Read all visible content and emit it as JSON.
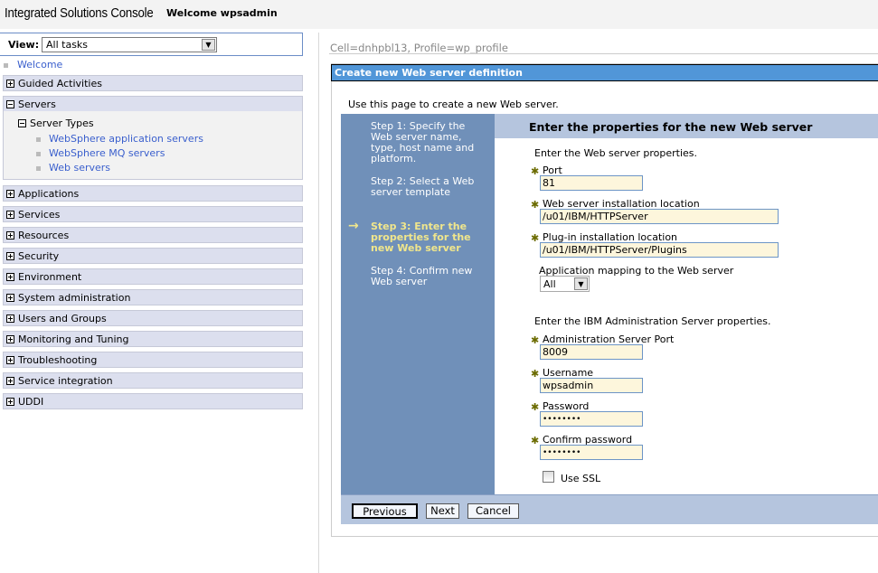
{
  "header": {
    "app_title": "Integrated Solutions Console",
    "welcome": "Welcome wpsadmin"
  },
  "sidebar": {
    "view_label": "View:",
    "view_value": "All tasks",
    "welcome_link": "Welcome",
    "guided": "Guided Activities",
    "servers": "Servers",
    "server_types": "Server Types",
    "server_links": [
      "WebSphere application servers",
      "WebSphere MQ servers",
      "Web servers"
    ],
    "sections": [
      "Applications",
      "Services",
      "Resources",
      "Security",
      "Environment",
      "System administration",
      "Users and Groups",
      "Monitoring and Tuning",
      "Troubleshooting",
      "Service integration",
      "UDDI"
    ]
  },
  "main": {
    "context": "Cell=dnhpbl13, Profile=wp_profile",
    "panel_title": "Create new Web server definition",
    "intro": "Use this page to create a new Web server.",
    "steps": [
      "Step 1: Specify the Web server name, type, host name and platform.",
      "Step 2: Select a Web server template",
      "Step 3: Enter the properties for the new Web server",
      "Step 4: Confirm new Web server"
    ],
    "form_title": "Enter the properties for the new Web server",
    "web_section": "Enter the Web server properties.",
    "port_label": "Port",
    "port_value": "81",
    "install_label": "Web server installation location",
    "install_value": "/u01/IBM/HTTPServer",
    "plugin_label": "Plug-in installation location",
    "plugin_value": "/u01/IBM/HTTPServer/Plugins",
    "mapping_label": "Application mapping to the Web server",
    "mapping_value": "All",
    "admin_section": "Enter the IBM Administration Server properties.",
    "admin_port_label": "Administration Server Port",
    "admin_port_value": "8009",
    "username_label": "Username",
    "username_value": "wpsadmin",
    "password_label": "Password",
    "password_value": "••••••••",
    "confirm_label": "Confirm password",
    "confirm_value": "••••••••",
    "ssl_label": "Use SSL",
    "ssl_checked": false,
    "buttons": {
      "previous": "Previous",
      "next": "Next",
      "cancel": "Cancel"
    }
  }
}
